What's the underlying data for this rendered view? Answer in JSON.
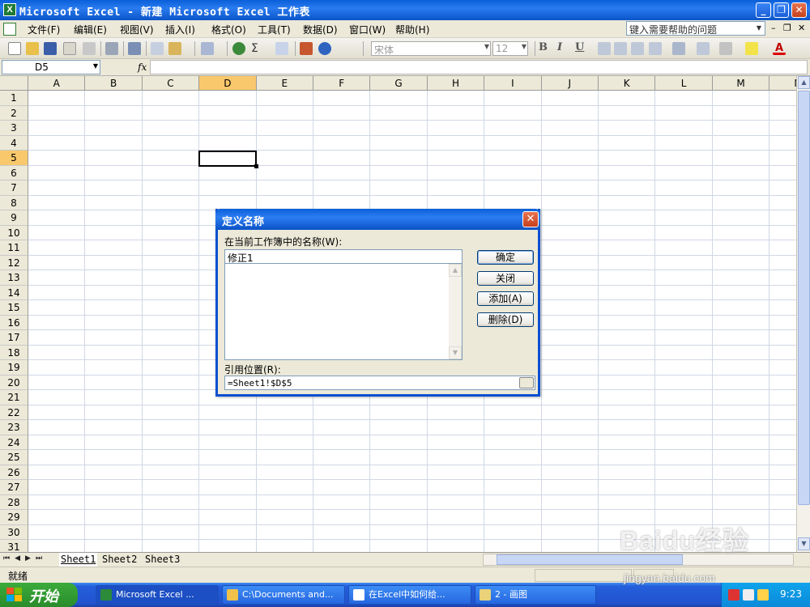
{
  "window": {
    "title": "Microsoft Excel - 新建 Microsoft Excel 工作表",
    "icon": "excel-icon",
    "controls": [
      "_",
      "❐",
      "✕"
    ]
  },
  "menubar": {
    "items": [
      "文件(F)",
      "编辑(E)",
      "视图(V)",
      "插入(I)",
      "格式(O)",
      "工具(T)",
      "数据(D)",
      "窗口(W)",
      "帮助(H)"
    ],
    "help_placeholder": "键入需要帮助的问题",
    "mdi_controls": [
      "–",
      "❐",
      "✕"
    ]
  },
  "toolbar": {
    "font_name": "宋体",
    "font_size": "12",
    "format_buttons": [
      "B",
      "I",
      "U"
    ]
  },
  "formula_bar": {
    "name_box": "D5",
    "fx_label": "fx",
    "formula": ""
  },
  "grid": {
    "columns": [
      "A",
      "B",
      "C",
      "D",
      "E",
      "F",
      "G",
      "H",
      "I",
      "J",
      "K",
      "L",
      "M",
      "N"
    ],
    "rows": [
      "1",
      "2",
      "3",
      "4",
      "5",
      "6",
      "7",
      "8",
      "9",
      "10",
      "11",
      "12",
      "13",
      "14",
      "15",
      "16",
      "17",
      "18",
      "19",
      "20",
      "21",
      "22",
      "23",
      "24",
      "25",
      "26",
      "27",
      "28",
      "29",
      "30",
      "31"
    ],
    "active_cell": "D5"
  },
  "sheets": {
    "tabs": [
      "Sheet1",
      "Sheet2",
      "Sheet3"
    ],
    "active": "Sheet1"
  },
  "statusbar": {
    "text": "就绪"
  },
  "dialog": {
    "title": "定义名称",
    "name_label": "在当前工作簿中的名称(W):",
    "name_value": "修正1",
    "ref_label": "引用位置(R):",
    "ref_value": "=Sheet1!$D$5",
    "buttons": {
      "ok": "确定",
      "close": "关闭",
      "add": "添加(A)",
      "delete": "删除(D)"
    }
  },
  "taskbar": {
    "start_label": "开始",
    "tasks": [
      "Microsoft Excel ...",
      "C:\\Documents and...",
      "在Excel中如何给...",
      "2 - 画图"
    ],
    "time": "9:23"
  },
  "watermark": {
    "brand": "Baidu经验",
    "url": "jingyan.baidu.com"
  },
  "colors": {
    "title_blue": "#0a5fd8",
    "chrome": "#ece9d8",
    "active_header": "#f9c86c",
    "start_green": "#2a8c2a"
  }
}
